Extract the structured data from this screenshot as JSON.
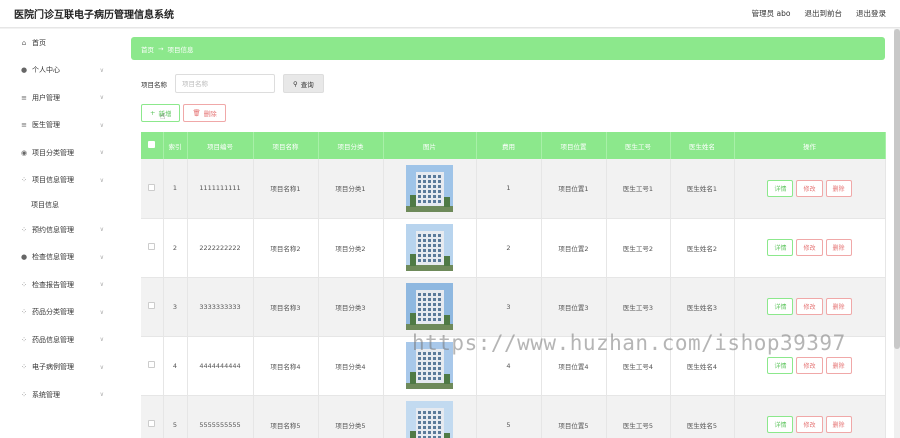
{
  "header": {
    "title": "医院门诊互联电子病历管理信息系统",
    "user": "管理员 abo",
    "back_label": "退出到前台",
    "logout_label": "退出登录"
  },
  "sidebar": {
    "items": [
      {
        "label": "首页",
        "icon": "home-icon",
        "glyph": "⌂",
        "chev": false
      },
      {
        "label": "个人中心",
        "icon": "user-icon",
        "glyph": "●",
        "chev": true
      },
      {
        "label": "用户管理",
        "icon": "list-icon",
        "glyph": "≡",
        "chev": true
      },
      {
        "label": "医生管理",
        "icon": "menu-icon",
        "glyph": "≡",
        "chev": true
      },
      {
        "label": "项目分类管理",
        "icon": "pin-icon",
        "glyph": "◉",
        "chev": true
      },
      {
        "label": "项目信息管理",
        "icon": "grid-icon",
        "glyph": "⁘",
        "chev": true
      }
    ],
    "sub_item": "项目信息",
    "items2": [
      {
        "label": "预约信息管理",
        "icon": "grid-icon",
        "glyph": "⁘",
        "chev": true
      },
      {
        "label": "检查信息管理",
        "icon": "user-icon",
        "glyph": "●",
        "chev": true
      },
      {
        "label": "检查报告管理",
        "icon": "grid-icon",
        "glyph": "⁘",
        "chev": true
      },
      {
        "label": "药品分类管理",
        "icon": "grid-icon",
        "glyph": "⁘",
        "chev": true
      },
      {
        "label": "药品信息管理",
        "icon": "grid-icon",
        "glyph": "⁘",
        "chev": true
      },
      {
        "label": "电子病例管理",
        "icon": "grid-icon",
        "glyph": "⁘",
        "chev": true
      },
      {
        "label": "系统管理",
        "icon": "grid-icon",
        "glyph": "⁘",
        "chev": true
      }
    ]
  },
  "breadcrumb": {
    "home": "首页",
    "sep": "→",
    "current": "项目信息"
  },
  "search": {
    "label": "项目名称",
    "placeholder": "项目名称",
    "button": "查询"
  },
  "actions": {
    "add": "新增",
    "delete": "删除"
  },
  "table": {
    "headers": [
      "索引",
      "项目编号",
      "项目名称",
      "项目分类",
      "图片",
      "费用",
      "项目位置",
      "医生工号",
      "医生姓名",
      "操作"
    ],
    "rows": [
      {
        "index": "1",
        "code": "1111111111",
        "name": "项目名称1",
        "category": "项目分类1",
        "fee": "1",
        "location": "项目位置1",
        "doctor_id": "医生工号1",
        "doctor_name": "医生姓名1"
      },
      {
        "index": "2",
        "code": "2222222222",
        "name": "项目名称2",
        "category": "项目分类2",
        "fee": "2",
        "location": "项目位置2",
        "doctor_id": "医生工号2",
        "doctor_name": "医生姓名2"
      },
      {
        "index": "3",
        "code": "3333333333",
        "name": "项目名称3",
        "category": "项目分类3",
        "fee": "3",
        "location": "项目位置3",
        "doctor_id": "医生工号3",
        "doctor_name": "医生姓名3"
      },
      {
        "index": "4",
        "code": "4444444444",
        "name": "项目名称4",
        "category": "项目分类4",
        "fee": "4",
        "location": "项目位置4",
        "doctor_id": "医生工号4",
        "doctor_name": "医生姓名4"
      },
      {
        "index": "5",
        "code": "5555555555",
        "name": "项目名称5",
        "category": "项目分类5",
        "fee": "5",
        "location": "项目位置5",
        "doctor_id": "医生工号5",
        "doctor_name": "医生姓名5"
      }
    ],
    "ops": {
      "detail": "详情",
      "edit": "修改",
      "delete": "删除"
    }
  },
  "watermark": "https://www.huzhan.com/ishop39397",
  "colors": {
    "accent": "#8ce88c",
    "danger": "#e57373"
  }
}
